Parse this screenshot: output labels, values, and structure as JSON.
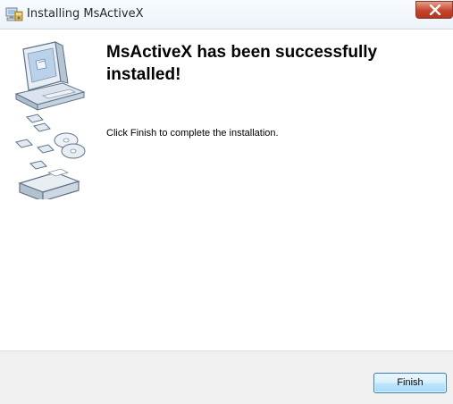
{
  "window": {
    "title": "Installing MsActiveX",
    "icons": {
      "app": "installer-icon",
      "close": "close-icon",
      "art": "computer-disks-icon"
    }
  },
  "main": {
    "heading": "MsActiveX has been successfully installed!",
    "message": "Click Finish to complete the installation."
  },
  "footer": {
    "finish_label": "Finish"
  },
  "colors": {
    "close_button": "#c7432c",
    "footer_bg": "#f0f0f0",
    "button_border": "#3c7fb1"
  }
}
